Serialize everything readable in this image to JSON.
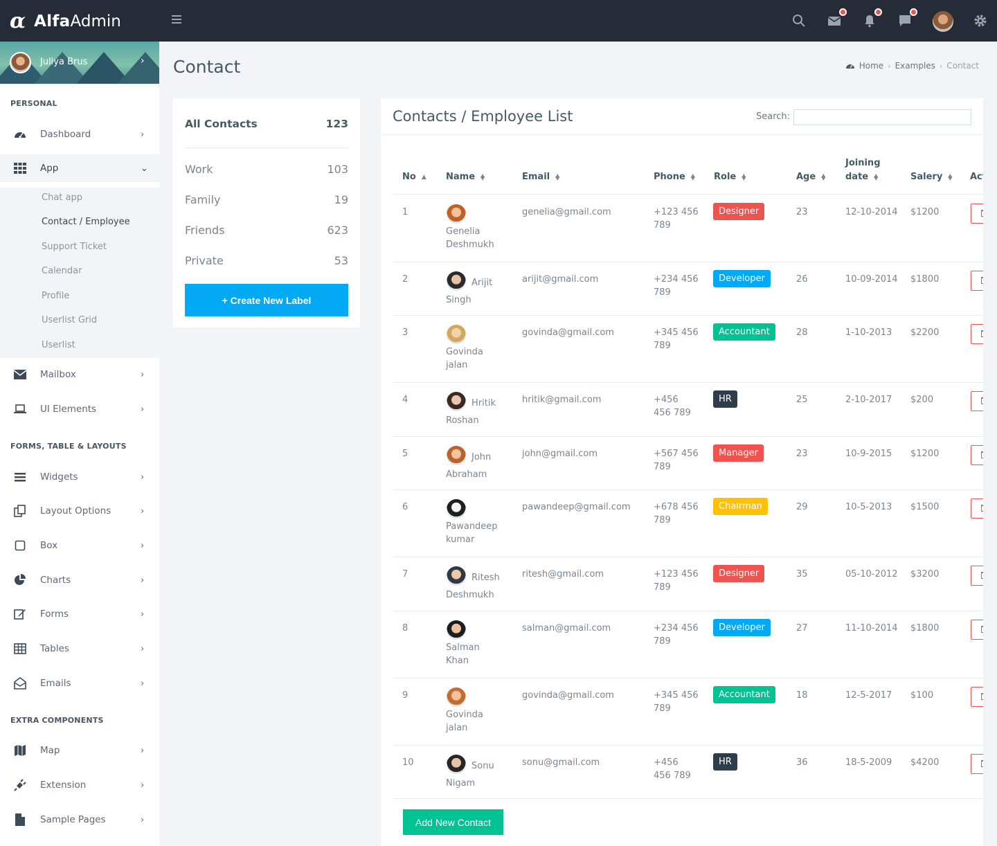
{
  "brand": {
    "logo": "α",
    "name_bold": "Alfa",
    "name_light": "Admin"
  },
  "topbar": {
    "icons": [
      "menu-icon",
      "search-icon",
      "mail-icon",
      "bell-icon",
      "chat-icon",
      "avatar",
      "gear-icon"
    ]
  },
  "sidebar": {
    "user": "Juliya Brus",
    "sections": [
      "PERSONAL",
      "FORMS, TABLE & LAYOUTS",
      "EXTRA COMPONENTS"
    ],
    "items": [
      {
        "label": "Dashboard",
        "icon": "dashboard-icon"
      },
      {
        "label": "App",
        "icon": "apps-grid-icon"
      },
      {
        "label": "Mailbox",
        "icon": "envelope-icon"
      },
      {
        "label": "UI Elements",
        "icon": "laptop-icon"
      },
      {
        "label": "Widgets",
        "icon": "bars-icon"
      },
      {
        "label": "Layout Options",
        "icon": "copy-icon"
      },
      {
        "label": "Box",
        "icon": "square-icon"
      },
      {
        "label": "Charts",
        "icon": "pie-chart-icon"
      },
      {
        "label": "Forms",
        "icon": "edit-icon"
      },
      {
        "label": "Tables",
        "icon": "table-icon"
      },
      {
        "label": "Emails",
        "icon": "envelope-open-icon"
      },
      {
        "label": "Map",
        "icon": "map-icon"
      },
      {
        "label": "Extension",
        "icon": "plug-icon"
      },
      {
        "label": "Sample Pages",
        "icon": "file-icon"
      }
    ],
    "app_sub": [
      "Chat app",
      "Contact / Employee",
      "Support Ticket",
      "Calendar",
      "Profile",
      "Userlist Grid",
      "Userlist"
    ]
  },
  "page": {
    "title": "Contact",
    "breadcrumb": [
      "Home",
      "Examples",
      "Contact"
    ]
  },
  "labels": {
    "all": {
      "name": "All Contacts",
      "count": "123"
    },
    "items": [
      {
        "name": "Work",
        "count": "103"
      },
      {
        "name": "Family",
        "count": "19"
      },
      {
        "name": "Friends",
        "count": "623"
      },
      {
        "name": "Private",
        "count": "53"
      }
    ],
    "create_button": "+ Create New Label"
  },
  "contacts": {
    "title": "Contacts / Employee List",
    "search_label": "Search:",
    "columns": [
      "No",
      "Name",
      "Email",
      "Phone",
      "Role",
      "Age",
      "Joining",
      "date",
      "Salery",
      "Action"
    ],
    "rows": [
      {
        "no": "1",
        "name1": "",
        "name2": "Genelia",
        "name3": "Deshmukh",
        "email": "genelia@gmail.com",
        "phone1": "+123 456",
        "phone2": "789",
        "role": "Designer",
        "age": "23",
        "date": "12-10-2014",
        "salary": "$1200"
      },
      {
        "no": "2",
        "name1": "Arijit",
        "name2": "Singh",
        "name3": "",
        "email": "arijit@gmail.com",
        "phone1": "+234 456",
        "phone2": "789",
        "role": "Developer",
        "age": "26",
        "date": "10-09-2014",
        "salary": "$1800"
      },
      {
        "no": "3",
        "name1": "",
        "name2": "Govinda",
        "name3": "jalan",
        "email": "govinda@gmail.com",
        "phone1": "+345 456",
        "phone2": "789",
        "role": "Accountant",
        "age": "28",
        "date": "1-10-2013",
        "salary": "$2200"
      },
      {
        "no": "4",
        "name1": "Hritik",
        "name2": "Roshan",
        "name3": "",
        "email": "hritik@gmail.com",
        "phone1": "+456",
        "phone2": "456 789",
        "role": "HR",
        "age": "25",
        "date": "2-10-2017",
        "salary": "$200"
      },
      {
        "no": "5",
        "name1": "John",
        "name2": "Abraham",
        "name3": "",
        "email": "john@gmail.com",
        "phone1": "+567 456",
        "phone2": "789",
        "role": "Manager",
        "age": "23",
        "date": "10-9-2015",
        "salary": "$1200"
      },
      {
        "no": "6",
        "name1": "",
        "name2": "Pawandeep",
        "name3": "kumar",
        "email": "pawandeep@gmail.com",
        "phone1": "+678 456",
        "phone2": "789",
        "role": "Chairman",
        "age": "29",
        "date": "10-5-2013",
        "salary": "$1500"
      },
      {
        "no": "7",
        "name1": "Ritesh",
        "name2": "Deshmukh",
        "name3": "",
        "email": "ritesh@gmail.com",
        "phone1": "+123 456",
        "phone2": "789",
        "role": "Designer",
        "age": "35",
        "date": "05-10-2012",
        "salary": "$3200"
      },
      {
        "no": "8",
        "name1": "",
        "name2": "Salman",
        "name3": "Khan",
        "email": "salman@gmail.com",
        "phone1": "+234 456",
        "phone2": "789",
        "role": "Developer",
        "age": "27",
        "date": "11-10-2014",
        "salary": "$1800"
      },
      {
        "no": "9",
        "name1": "",
        "name2": "Govinda",
        "name3": "jalan",
        "email": "govinda@gmail.com",
        "phone1": "+345 456",
        "phone2": "789",
        "role": "Accountant",
        "age": "18",
        "date": "12-5-2017",
        "salary": "$100"
      },
      {
        "no": "10",
        "name1": "Sonu",
        "name2": "Nigam",
        "name3": "",
        "email": "sonu@gmail.com",
        "phone1": "+456",
        "phone2": "456 789",
        "role": "HR",
        "age": "36",
        "date": "18-5-2009",
        "salary": "$4200"
      }
    ],
    "add_button": "Add New Contact"
  },
  "colors": {
    "Designer": "#ef5350",
    "Developer": "#03a9f3",
    "Accountant": "#00c292",
    "HR": "#2f3d4a",
    "Manager": "#ef5350",
    "Chairman": "#fec107"
  }
}
